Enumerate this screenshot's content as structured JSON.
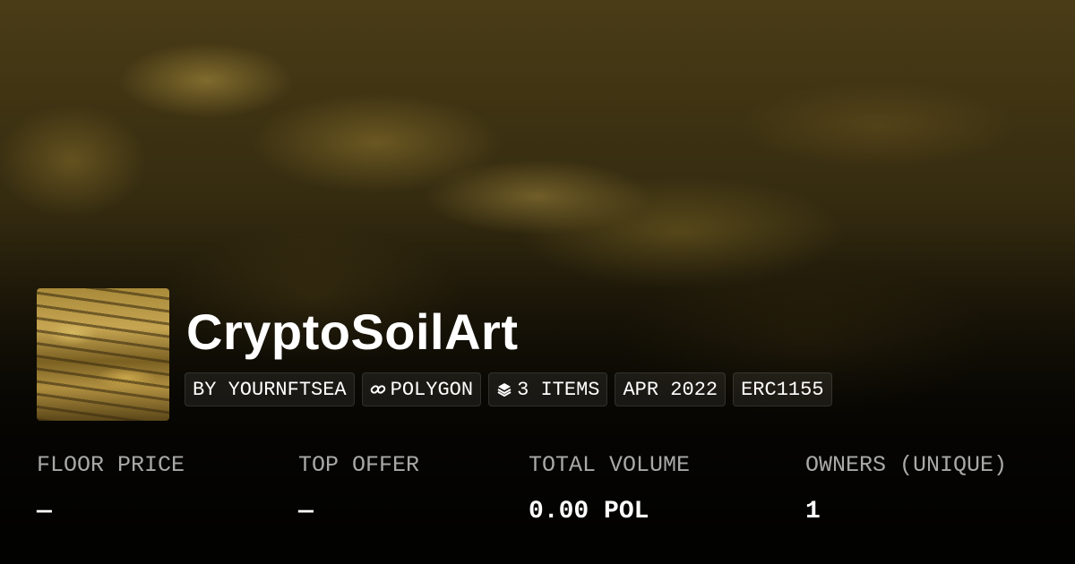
{
  "collection": {
    "name": "CryptoSoilArt"
  },
  "tags": {
    "creator": "BY YOURNFTSEA",
    "chain": "POLYGON",
    "chain_icon": "link-icon",
    "items": "3 ITEMS",
    "items_icon": "layers-icon",
    "date": "APR 2022",
    "standard": "ERC1155"
  },
  "stats": [
    {
      "label": "FLOOR PRICE",
      "value": "—"
    },
    {
      "label": "TOP OFFER",
      "value": "—"
    },
    {
      "label": "TOTAL VOLUME",
      "value": "0.00 POL"
    },
    {
      "label": "OWNERS (UNIQUE)",
      "value": "1"
    }
  ],
  "colors": {
    "text_primary": "#ffffff",
    "text_secondary": "#a9a9a9",
    "banner_tone": "#4a3c16"
  }
}
